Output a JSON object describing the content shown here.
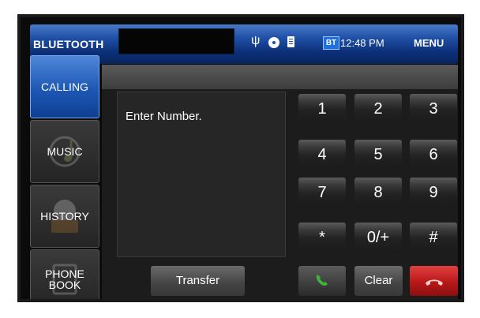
{
  "header": {
    "title": "BLUETOOTH",
    "bt_badge": "BT",
    "time": "12:48 PM",
    "menu_label": "MENU",
    "usb_icon": "usb-icon",
    "usb_glyph": "ψ"
  },
  "sidebar": {
    "items": [
      {
        "label": "CALLING",
        "active": true
      },
      {
        "label": "MUSIC",
        "active": false
      },
      {
        "label": "HISTORY",
        "active": false
      },
      {
        "label_line1": "PHONE",
        "label_line2": "BOOK",
        "active": false
      }
    ]
  },
  "entry": {
    "placeholder": "Enter Number."
  },
  "keypad": {
    "keys": [
      "1",
      "2",
      "3",
      "4",
      "5",
      "6",
      "7",
      "8",
      "9",
      "*",
      "0/+",
      "#"
    ]
  },
  "actions": {
    "transfer_label": "Transfer",
    "clear_label": "Clear",
    "call_icon": "phone-call-icon",
    "end_icon": "phone-hangup-icon"
  },
  "colors": {
    "header_blue": "#1f4fa5",
    "active_tab_blue": "#1d58b5",
    "call_green": "#3fb23a",
    "end_red": "#c0191a"
  }
}
